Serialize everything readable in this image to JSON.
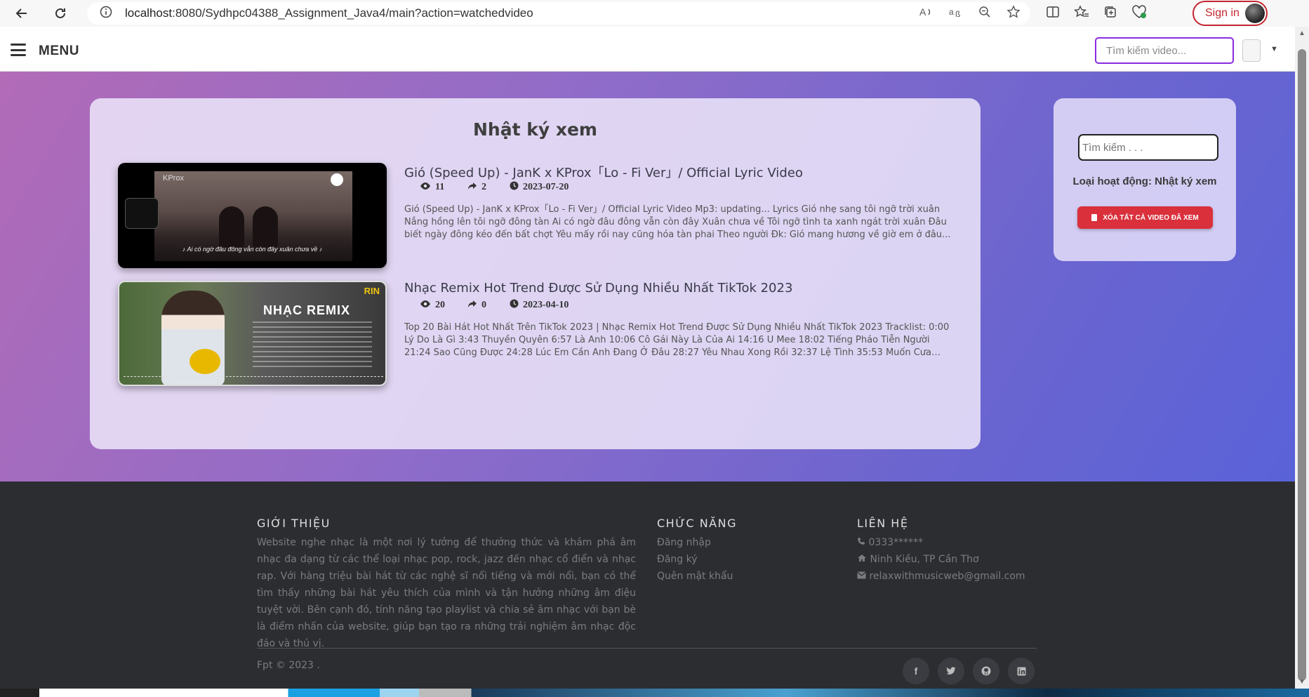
{
  "browser": {
    "url_host": "localhost",
    "url_path": ":8080/Sydhpc04388_Assignment_Java4/main?action=watchedvideo",
    "signin_label": "Sign in"
  },
  "navbar": {
    "menu_label": "MENU",
    "search_placeholder": "Tìm kiếm video..."
  },
  "history": {
    "title": "Nhật ký xem",
    "videos": [
      {
        "title": "Gió (Speed Up) - JanK x KProx「Lo - Fi Ver」/ Official Lyric Video",
        "views": "11",
        "shares": "2",
        "date": "2023-07-20",
        "description": "Gió (Speed Up) - JanK x KProx「Lo - Fi Ver」/ Official Lyric Video Mp3: updating... Lyrics Gió nhẹ sang tôi ngỡ trời xuân Nắng hồng lên tôi ngỡ đông tàn Ai có ngờ đâu đông vẫn còn đây Xuân chưa về Tôi ngỡ tình ta xanh ngát trời xuân Đâu biết ngày đông kéo đến bất chợt Yêu mấy rồi nay cũng hóa tàn phai Theo người Đk: Gió mang hương về giờ em ở đâu...",
        "thumb_logo": "KProx",
        "thumb_caption": "♪ Ai có ngờ đâu đông vẫn còn đây xuân chưa về ♪"
      },
      {
        "title": "Nhạc Remix Hot Trend Được Sử Dụng Nhiều Nhất TikTok 2023",
        "views": "20",
        "shares": "0",
        "date": "2023-04-10",
        "description": "Top 20 Bài Hát Hot Nhất Trên TikTok 2023 | Nhạc Remix Hot Trend Được Sử Dụng Nhiều Nhất TikTok 2023 Tracklist: 0:00 Lý Do Là Gì 3:43 Thuyền Quyên 6:57 Là Anh 10:06 Cô Gái Này Là Của Ai 14:16 U Mee 18:02 Tiếng Pháo Tiễn Người 21:24 Sao Cũng Được 24:28 Lúc Em Cần Anh Đang Ở Đâu 28:27 Yêu Nhau Xong Rồi 32:37 Lệ Tình 35:53 Muốn Cưa Hay Được Cưa...",
        "thumb_text": "NHẠC REMIX",
        "thumb_badge": "RIN"
      }
    ]
  },
  "sidebar": {
    "search_placeholder": "Tìm kiếm . . .",
    "activity_label": "Loại hoạt động: Nhật ký xem",
    "clear_button": "XÓA TẤT CẢ VIDEO ĐÃ XEM"
  },
  "footer": {
    "about_heading": "GIỚI THIỆU",
    "about_text": "Website nghe nhạc là một nơi lý tưởng để thưởng thức và khám phá âm nhạc đa dạng từ các thể loại nhạc pop, rock, jazz đến nhạc cổ điển và nhạc rap. Với hàng triệu bài hát từ các nghệ sĩ nổi tiếng và mới nổi, bạn có thể tìm thấy những bài hát yêu thích của mình và tận hưởng những âm điệu tuyệt vời. Bên cạnh đó, tính năng tạo playlist và chia sẻ âm nhạc với bạn bè là điểm nhấn của website, giúp bạn tạo ra những trải nghiệm âm nhạc độc đáo và thú vị.",
    "functions_heading": "CHỨC NĂNG",
    "functions": [
      "Đăng nhập",
      "Đăng ký",
      "Quên mật khẩu"
    ],
    "contact_heading": "LIÊN HỆ",
    "phone": "0333******",
    "address": "Ninh Kiều, TP Cần Thơ",
    "email": "relaxwithmusicweb@gmail.com",
    "copyright": "Fpt © 2023 .",
    "social_icons": [
      "facebook-icon",
      "twitter-icon",
      "github-icon",
      "linkedin-icon"
    ]
  },
  "colors": {
    "accent": "#8a2be2",
    "danger": "#d9303c",
    "footer_bg": "#2b2d31"
  }
}
